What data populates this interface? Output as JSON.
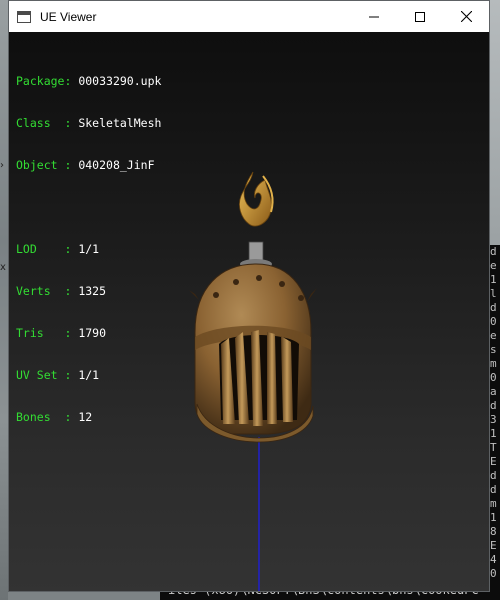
{
  "window": {
    "title": "UE Viewer",
    "minimize_icon": "minimize-icon",
    "maximize_icon": "maximize-icon",
    "close_icon": "close-icon"
  },
  "info": {
    "package": {
      "label": "Package:",
      "value": "00033290.upk"
    },
    "class": {
      "label": "Class  :",
      "value": "SkeletalMesh"
    },
    "object": {
      "label": "Object :",
      "value": "040208_JinF"
    },
    "lod": {
      "label": "LOD    :",
      "value": "1/1"
    },
    "verts": {
      "label": "Verts  :",
      "value": "1325"
    },
    "tris": {
      "label": "Tris   :",
      "value": "1790"
    },
    "uvset": {
      "label": "UV Set :",
      "value": "1/1"
    },
    "bones": {
      "label": "Bones  :",
      "value": "12"
    }
  },
  "background": {
    "console_bottom_text": "iles (x86)\\NCSOFT\\BnS\\contents\\bns\\CookedPC",
    "console_chars": "d\ne\n1\nl\nd\n0\ne\ns\nm\n0\na\nd\n3\n1\nT\nE\nd\nd\nm\n1\n8\nE\n4\n0\nd\ne\nx",
    "marker_right": "›",
    "marker_left": "x"
  },
  "colors": {
    "label": "#33dd33",
    "value": "#ffffff",
    "helmet_bronze": "#8a6232",
    "flame": "#d49a2a",
    "axis_line": "#2020cc",
    "glow": "#4d35ff"
  }
}
